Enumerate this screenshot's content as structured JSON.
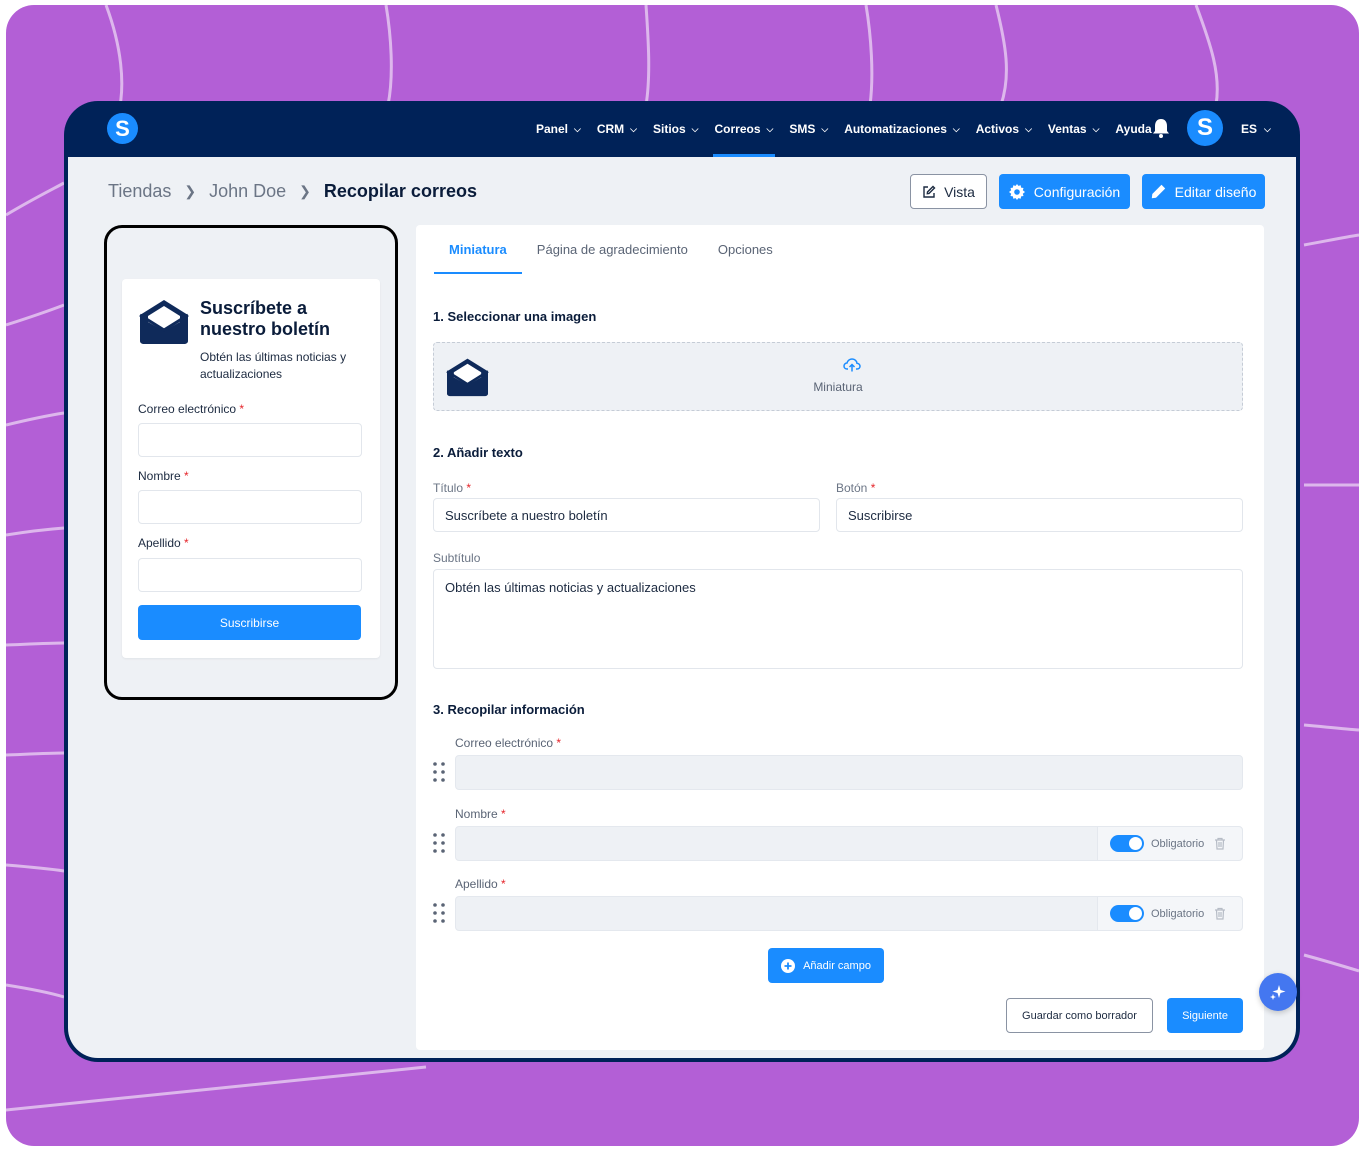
{
  "colors": {
    "background": "#b35fd6",
    "nav": "#002258",
    "accent": "#1a8cff",
    "required": "#e5252a"
  },
  "nav": {
    "logo": "S",
    "items": [
      {
        "label": "Panel",
        "has_menu": true
      },
      {
        "label": "CRM",
        "has_menu": true
      },
      {
        "label": "Sitios",
        "has_menu": true
      },
      {
        "label": "Correos",
        "has_menu": true,
        "active": true
      },
      {
        "label": "SMS",
        "has_menu": true
      },
      {
        "label": "Automatizaciones",
        "has_menu": true
      },
      {
        "label": "Activos",
        "has_menu": true
      },
      {
        "label": "Ventas",
        "has_menu": true
      },
      {
        "label": "Ayuda",
        "has_menu": false
      }
    ],
    "bell_icon": "bell-icon",
    "avatar": "S",
    "language": "ES"
  },
  "breadcrumb": {
    "items": [
      "Tiendas",
      "John Doe"
    ],
    "current": "Recopilar correos"
  },
  "actions": {
    "view": "Vista",
    "settings": "Configuración",
    "edit_design": "Editar diseño"
  },
  "preview": {
    "title": "Suscríbete a nuestro boletín",
    "subtitle": "Obtén las últimas noticias y actualizaciones",
    "fields": [
      {
        "label": "Correo electrónico",
        "required": "*"
      },
      {
        "label": "Nombre",
        "required": "*"
      },
      {
        "label": "Apellido",
        "required": "*"
      }
    ],
    "button": "Suscribirse"
  },
  "tabs": [
    {
      "label": "Miniatura",
      "active": true
    },
    {
      "label": "Página de agradecimiento"
    },
    {
      "label": "Opciones"
    }
  ],
  "section_image": {
    "title": "1. Seleccionar una imagen",
    "upload_label": "Miniatura"
  },
  "section_text": {
    "title": "2. Añadir texto",
    "title_label": "Título",
    "title_value": "Suscríbete a nuestro boletín",
    "button_label": "Botón",
    "button_value": "Suscribirse",
    "subtitle_label": "Subtítulo",
    "subtitle_value": "Obtén las últimas noticias y actualizaciones",
    "required": "*"
  },
  "section_collect": {
    "title": "3. Recopilar información",
    "fields": [
      {
        "label": "Correo electrónico",
        "required": "*"
      },
      {
        "label": "Nombre",
        "required": "*",
        "toggle": "Obligatorio",
        "toggle_on": true
      },
      {
        "label": "Apellido",
        "required": "*",
        "toggle": "Obligatorio",
        "toggle_on": true
      }
    ],
    "add_field": "Añadir campo"
  },
  "footer": {
    "save_draft": "Guardar como borrador",
    "next": "Siguiente"
  }
}
